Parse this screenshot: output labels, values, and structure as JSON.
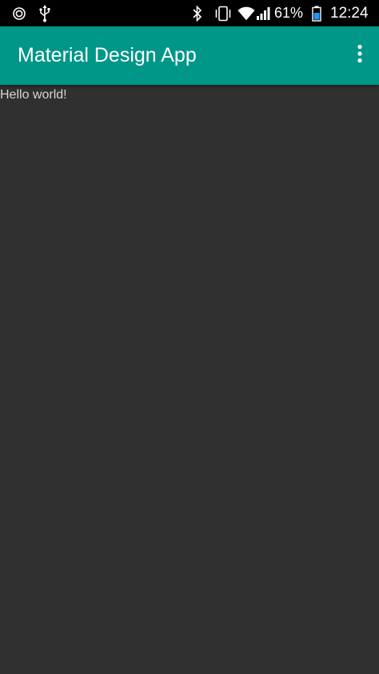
{
  "status_bar": {
    "battery_percent": "61%",
    "time": "12:24",
    "icons": [
      "notification-ring-icon",
      "usb-icon",
      "bluetooth-icon",
      "vibrate-icon",
      "wifi-icon",
      "signal-icon",
      "battery-icon"
    ]
  },
  "app_bar": {
    "title": "Material Design App",
    "overflow_icon": "more-vert-icon"
  },
  "content": {
    "text": "Hello world!"
  },
  "colors": {
    "primary": "#009688",
    "background": "#303030",
    "status_bar": "#000000"
  }
}
